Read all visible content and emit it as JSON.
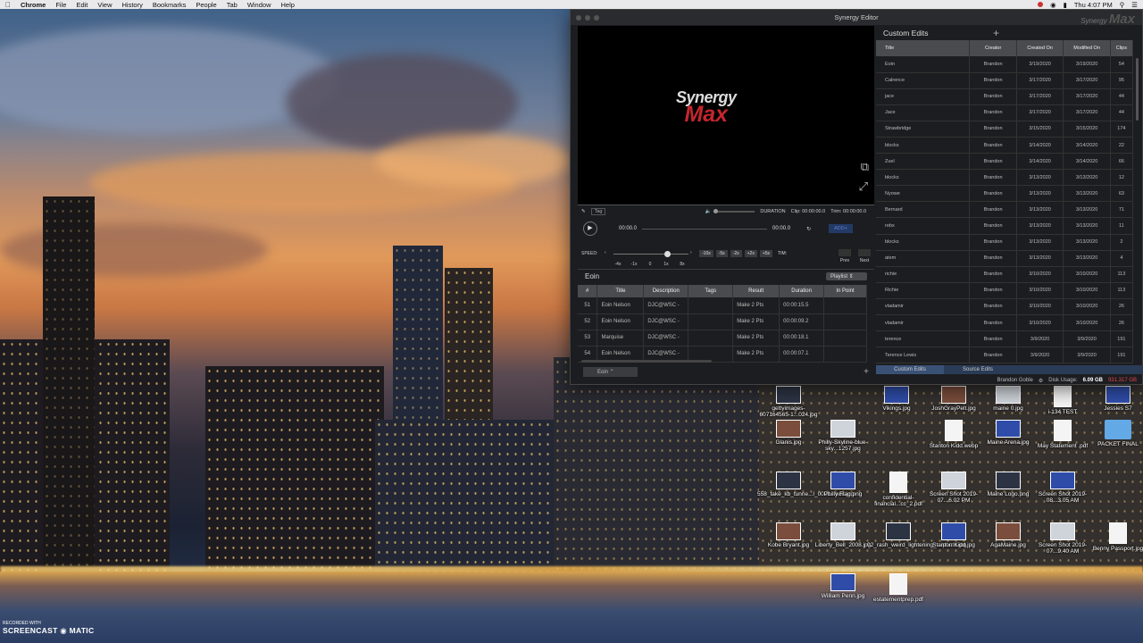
{
  "menubar": {
    "app": "Chrome",
    "items": [
      "File",
      "Edit",
      "View",
      "History",
      "Bookmarks",
      "People",
      "Tab",
      "Window",
      "Help"
    ],
    "clock": "Thu 4:07 PM"
  },
  "window": {
    "title": "Synergy Editor",
    "brand_small": "Synergy",
    "brand_big": "Max"
  },
  "player": {
    "logo_top": "Synergy",
    "logo_bottom": "Max",
    "tag_label": "Tag",
    "duration_label": "DURATION",
    "clip_time": "Clip: 00:00:00.0",
    "trim_time": "Trim: 00:00:00.0",
    "time_current": "00:00.0",
    "time_total": "00:00.0",
    "add_label": "ADD+",
    "speed_label": "SPEED:",
    "speed_ticks": [
      "-4x",
      "-1x",
      "0",
      "1x",
      "8x"
    ],
    "speed_level_fraction": 0.72,
    "speed_buttons": [
      "-10s",
      "-5s",
      "-2s",
      "+2s",
      "+5s"
    ],
    "tim_label": "TIM:",
    "prev_label": "Prev",
    "next_label": "Next"
  },
  "playlist": {
    "title": "Eoin",
    "selector": "Playlist",
    "columns": [
      "#",
      "Title",
      "Description",
      "Tags",
      "Result",
      "Duration",
      "In Point"
    ],
    "rows": [
      {
        "num": "51",
        "title": "Eoin Nelson",
        "description": "DJC@WSC -",
        "tags": "",
        "result": "Make 2 Pts",
        "duration": "00:00:15.5",
        "in_point": ""
      },
      {
        "num": "52",
        "title": "Eoin Nelson",
        "description": "DJC@WSC -",
        "tags": "",
        "result": "Make 2 Pts",
        "duration": "00:00:09.2",
        "in_point": ""
      },
      {
        "num": "53",
        "title": "Marquise",
        "description": "DJC@WSC -",
        "tags": "",
        "result": "Make 2 Pts",
        "duration": "00:00:18.1",
        "in_point": ""
      },
      {
        "num": "54",
        "title": "Eoin Nelson",
        "description": "DJC@WSC -",
        "tags": "",
        "result": "Make 2 Pts",
        "duration": "00:00:07.1",
        "in_point": ""
      }
    ],
    "footer_tab": "Eoin"
  },
  "custom_edits": {
    "title": "Custom Edits",
    "columns": [
      "Title",
      "Creator",
      "Created On",
      "Modified On",
      "Clips"
    ],
    "rows": [
      [
        "Eoin",
        "Brandon",
        "3/19/2020",
        "3/19/2020",
        "54"
      ],
      [
        "Calrence",
        "Brandon",
        "3/17/2020",
        "3/17/2020",
        "95"
      ],
      [
        "jace",
        "Brandon",
        "3/17/2020",
        "3/17/2020",
        "44"
      ],
      [
        "Jace",
        "Brandon",
        "3/17/2020",
        "3/17/2020",
        "44"
      ],
      [
        "Strawbridge",
        "Brandon",
        "3/15/2020",
        "3/15/2020",
        "174"
      ],
      [
        "blocks",
        "Brandon",
        "3/14/2020",
        "3/14/2020",
        "22"
      ],
      [
        "Zuel",
        "Brandon",
        "3/14/2020",
        "3/14/2020",
        "66"
      ],
      [
        "blocks",
        "Brandon",
        "3/13/2020",
        "3/13/2020",
        "12"
      ],
      [
        "Nyowe",
        "Brandon",
        "3/13/2020",
        "3/13/2020",
        "63"
      ],
      [
        "Bernard",
        "Brandon",
        "3/13/2020",
        "3/13/2020",
        "71"
      ],
      [
        "rebs",
        "Brandon",
        "3/13/2020",
        "3/13/2020",
        "11"
      ],
      [
        "blocks",
        "Brandon",
        "3/13/2020",
        "3/13/2020",
        "2"
      ],
      [
        "atem",
        "Brandon",
        "3/13/2020",
        "3/13/2020",
        "4"
      ],
      [
        "richie",
        "Brandon",
        "3/10/2020",
        "3/10/2020",
        "113"
      ],
      [
        "Richie",
        "Brandon",
        "3/10/2020",
        "3/10/2020",
        "113"
      ],
      [
        "vladamir",
        "Brandon",
        "3/10/2020",
        "3/10/2020",
        "26"
      ],
      [
        "vladamir",
        "Brandon",
        "3/10/2020",
        "3/10/2020",
        "26"
      ],
      [
        "terence",
        "Brandon",
        "3/9/2020",
        "3/9/2020",
        "191"
      ],
      [
        "Terence Lewis",
        "Brandon",
        "3/9/2020",
        "3/9/2020",
        "191"
      ]
    ],
    "tabs": [
      "Custom Edits",
      "Source Edits"
    ],
    "active_tab": "Custom Edits",
    "user": "Brandon Goble",
    "disk_label": "Disk Usage:",
    "disk_used": "6.09 GB",
    "disk_free": "931.317 GB"
  },
  "desktop_icons": [
    {
      "label": "gettyimages-607164565-1...024.jpg",
      "kind": "photo"
    },
    {
      "label": "Vikings.jpg",
      "kind": "photo"
    },
    {
      "label": "JoshGrayPelt.jpg",
      "kind": "photo"
    },
    {
      "label": "maine 0.jpg",
      "kind": "photo"
    },
    {
      "label": "i-134 TEST",
      "kind": "doc"
    },
    {
      "label": "Jessies S7",
      "kind": "photo"
    },
    {
      "label": "Glanis.jpg",
      "kind": "photo"
    },
    {
      "label": "Philly-Skyline-blue-sky...1257.jpg",
      "kind": "photo"
    },
    {
      "label": "Stanton Kidd.webp",
      "kind": "doc"
    },
    {
      "label": "Maine Arena.jpg",
      "kind": "photo"
    },
    {
      "label": "May Statement .pdf",
      "kind": "doc"
    },
    {
      "label": "PACKET FINAL",
      "kind": "folder"
    },
    {
      "label": "558_take_kb_tunne...l_0001...edit.jpg",
      "kind": "photo"
    },
    {
      "label": "Philly Flag.png",
      "kind": "photo"
    },
    {
      "label": "confidential-financial...cc_2.pdf",
      "kind": "doc"
    },
    {
      "label": "Screen Shot 2019-07...6.02 PM",
      "kind": "photo"
    },
    {
      "label": "Maine Logo.png",
      "kind": "photo"
    },
    {
      "label": "Screen Shot 2019-08...3.05 AM",
      "kind": "photo"
    },
    {
      "label": "Kobe Bryant.jpg",
      "kind": "photo"
    },
    {
      "label": "Liberty_Bell_2008.jpg",
      "kind": "photo"
    },
    {
      "label": "02_rash_weird_lightening_...iphoto.jpg",
      "kind": "photo"
    },
    {
      "label": "Stanton Kidd.jpg",
      "kind": "photo"
    },
    {
      "label": "AgaMaine.jpg",
      "kind": "photo"
    },
    {
      "label": "Screen Shot 2019-07...9.40 AM",
      "kind": "photo"
    },
    {
      "label": "Benny Passport.jpg",
      "kind": "doc"
    },
    {
      "label": "William Penn.jpg",
      "kind": "photo"
    },
    {
      "label": "estatementprep.pdf",
      "kind": "doc"
    }
  ],
  "watermark": {
    "line1": "RECORDED WITH",
    "line2": "SCREENCAST",
    "line3": "MATIC"
  }
}
